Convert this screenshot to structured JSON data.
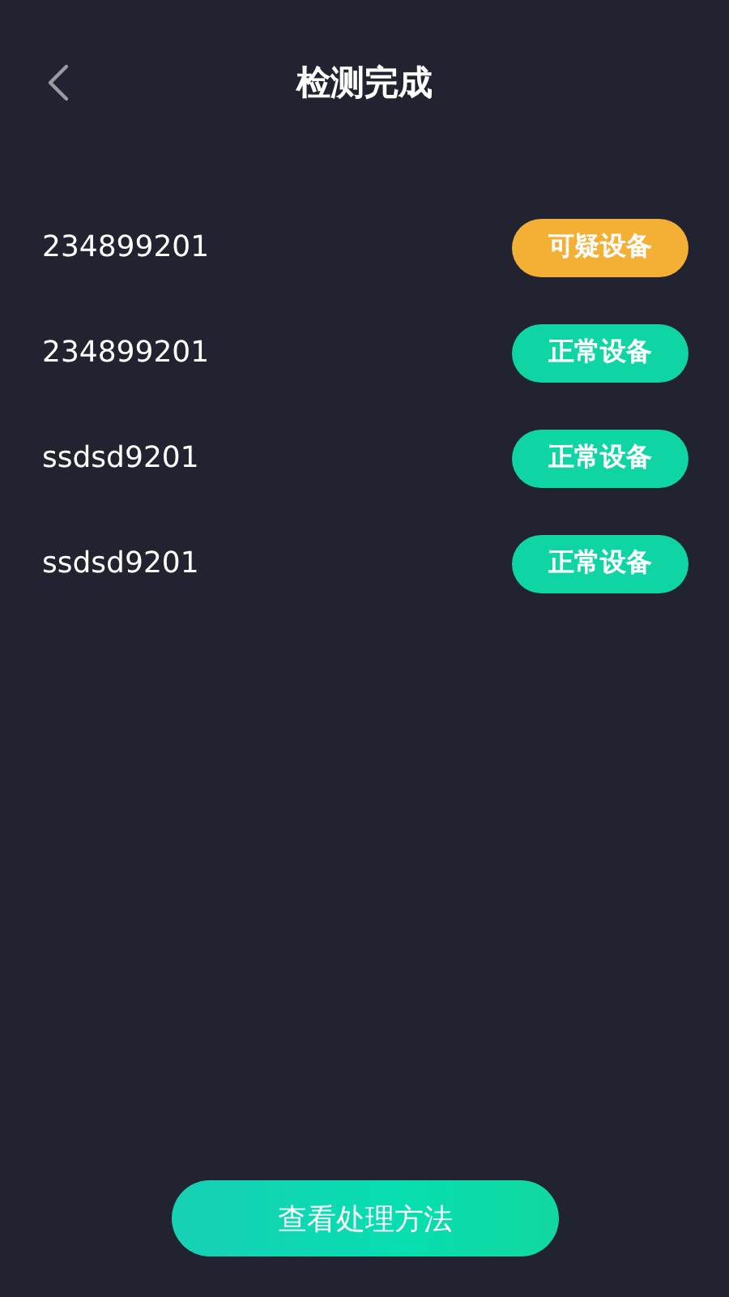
{
  "header": {
    "title": "检测完成"
  },
  "devices": [
    {
      "name": "234899201",
      "status": {
        "label": "可疑设备",
        "kind": "suspicious"
      }
    },
    {
      "name": "234899201",
      "status": {
        "label": "正常设备",
        "kind": "normal"
      }
    },
    {
      "name": "ssdsd9201",
      "status": {
        "label": "正常设备",
        "kind": "normal"
      }
    },
    {
      "name": "ssdsd9201",
      "status": {
        "label": "正常设备",
        "kind": "normal"
      }
    }
  ],
  "action_button": {
    "label": "查看处理方法"
  }
}
